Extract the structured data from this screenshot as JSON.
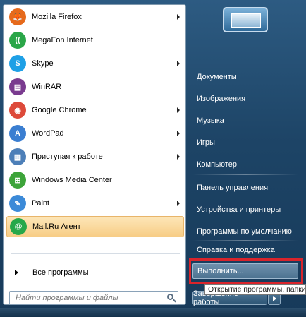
{
  "programs": [
    {
      "label": "Mozilla Firefox",
      "icon": "firefox-icon",
      "glyph": "🦊",
      "color": "#e66a1c",
      "arrow": true
    },
    {
      "label": "MegaFon Internet",
      "icon": "megafon-icon",
      "glyph": "((",
      "color": "#2aa648",
      "arrow": false
    },
    {
      "label": "Skype",
      "icon": "skype-icon",
      "glyph": "S",
      "color": "#1ea0e6",
      "arrow": true
    },
    {
      "label": "WinRAR",
      "icon": "winrar-icon",
      "glyph": "▤",
      "color": "#7a3b8f",
      "arrow": false
    },
    {
      "label": "Google Chrome",
      "icon": "chrome-icon",
      "glyph": "◉",
      "color": "#dd4a3a",
      "arrow": true
    },
    {
      "label": "WordPad",
      "icon": "wordpad-icon",
      "glyph": "A",
      "color": "#3a7ed1",
      "arrow": true
    },
    {
      "label": "Приступая к работе",
      "icon": "getting-started-icon",
      "glyph": "▦",
      "color": "#4d7fb8",
      "arrow": true
    },
    {
      "label": "Windows Media Center",
      "icon": "media-center-icon",
      "glyph": "⊞",
      "color": "#3da43a",
      "arrow": false
    },
    {
      "label": "Paint",
      "icon": "paint-icon",
      "glyph": "✎",
      "color": "#3b8ad8",
      "arrow": true
    },
    {
      "label": "Mail.Ru Агент",
      "icon": "mailru-agent-icon",
      "glyph": "@",
      "color": "#27a84a",
      "arrow": false
    }
  ],
  "all_programs": "Все программы",
  "search_placeholder": "Найти программы и файлы",
  "right_items": [
    "Документы",
    "Изображения",
    "Музыка",
    "Игры",
    "Компьютер",
    "Панель управления",
    "Устройства и принтеры",
    "Программы по умолчанию",
    "Справка и поддержка",
    "Выполнить..."
  ],
  "shutdown_label": "Завершение работы",
  "tooltip": "Открытие программы, папки"
}
